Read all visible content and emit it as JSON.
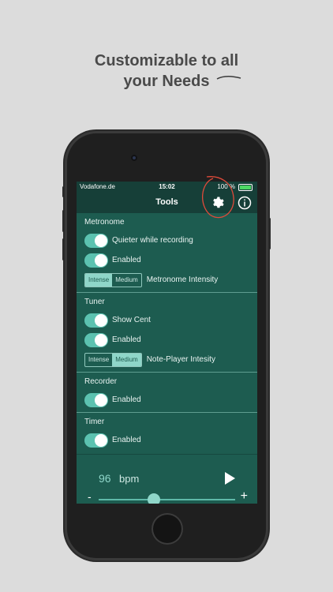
{
  "headline": {
    "line1": "Customizable to all",
    "line2": "your Needs"
  },
  "status": {
    "carrier": "Vodafone.de",
    "time": "15:02",
    "battery": "100 %"
  },
  "nav": {
    "title": "Tools"
  },
  "sections": {
    "metronome": {
      "title": "Metronome",
      "quieter_label": "Quieter while recording",
      "enabled_label": "Enabled",
      "seg_intense": "Intense",
      "seg_medium": "Medium",
      "intensity_label": "Metronome Intensity"
    },
    "tuner": {
      "title": "Tuner",
      "showcent_label": "Show Cent",
      "enabled_label": "Enabled",
      "seg_intense": "Intense",
      "seg_medium": "Medium",
      "intensity_label": "Note-Player Intesity"
    },
    "recorder": {
      "title": "Recorder",
      "enabled_label": "Enabled"
    },
    "timer": {
      "title": "Timer",
      "enabled_label": "Enabled"
    }
  },
  "player": {
    "bpm_value": "96",
    "bpm_unit": "bpm",
    "minus": "-",
    "plus": "+"
  },
  "colors": {
    "background": "#dcdcdc",
    "screen": "#1d5c50",
    "toggle": "#5cc2b0",
    "annotation": "#e04a3a"
  }
}
